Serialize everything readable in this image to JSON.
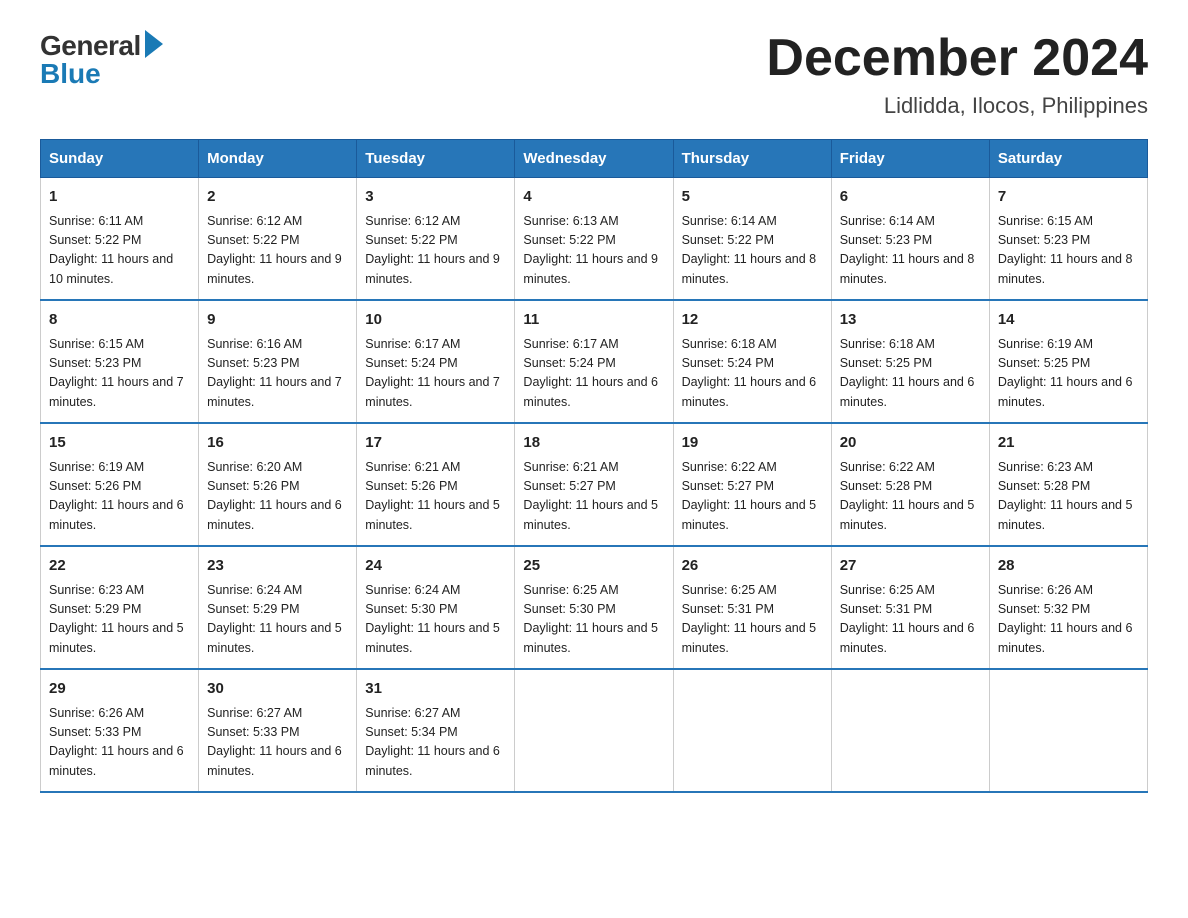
{
  "logo": {
    "general": "General",
    "blue": "Blue"
  },
  "title": "December 2024",
  "subtitle": "Lidlidda, Ilocos, Philippines",
  "days_of_week": [
    "Sunday",
    "Monday",
    "Tuesday",
    "Wednesday",
    "Thursday",
    "Friday",
    "Saturday"
  ],
  "weeks": [
    [
      {
        "day": "1",
        "sunrise": "6:11 AM",
        "sunset": "5:22 PM",
        "daylight": "11 hours and 10 minutes."
      },
      {
        "day": "2",
        "sunrise": "6:12 AM",
        "sunset": "5:22 PM",
        "daylight": "11 hours and 9 minutes."
      },
      {
        "day": "3",
        "sunrise": "6:12 AM",
        "sunset": "5:22 PM",
        "daylight": "11 hours and 9 minutes."
      },
      {
        "day": "4",
        "sunrise": "6:13 AM",
        "sunset": "5:22 PM",
        "daylight": "11 hours and 9 minutes."
      },
      {
        "day": "5",
        "sunrise": "6:14 AM",
        "sunset": "5:22 PM",
        "daylight": "11 hours and 8 minutes."
      },
      {
        "day": "6",
        "sunrise": "6:14 AM",
        "sunset": "5:23 PM",
        "daylight": "11 hours and 8 minutes."
      },
      {
        "day": "7",
        "sunrise": "6:15 AM",
        "sunset": "5:23 PM",
        "daylight": "11 hours and 8 minutes."
      }
    ],
    [
      {
        "day": "8",
        "sunrise": "6:15 AM",
        "sunset": "5:23 PM",
        "daylight": "11 hours and 7 minutes."
      },
      {
        "day": "9",
        "sunrise": "6:16 AM",
        "sunset": "5:23 PM",
        "daylight": "11 hours and 7 minutes."
      },
      {
        "day": "10",
        "sunrise": "6:17 AM",
        "sunset": "5:24 PM",
        "daylight": "11 hours and 7 minutes."
      },
      {
        "day": "11",
        "sunrise": "6:17 AM",
        "sunset": "5:24 PM",
        "daylight": "11 hours and 6 minutes."
      },
      {
        "day": "12",
        "sunrise": "6:18 AM",
        "sunset": "5:24 PM",
        "daylight": "11 hours and 6 minutes."
      },
      {
        "day": "13",
        "sunrise": "6:18 AM",
        "sunset": "5:25 PM",
        "daylight": "11 hours and 6 minutes."
      },
      {
        "day": "14",
        "sunrise": "6:19 AM",
        "sunset": "5:25 PM",
        "daylight": "11 hours and 6 minutes."
      }
    ],
    [
      {
        "day": "15",
        "sunrise": "6:19 AM",
        "sunset": "5:26 PM",
        "daylight": "11 hours and 6 minutes."
      },
      {
        "day": "16",
        "sunrise": "6:20 AM",
        "sunset": "5:26 PM",
        "daylight": "11 hours and 6 minutes."
      },
      {
        "day": "17",
        "sunrise": "6:21 AM",
        "sunset": "5:26 PM",
        "daylight": "11 hours and 5 minutes."
      },
      {
        "day": "18",
        "sunrise": "6:21 AM",
        "sunset": "5:27 PM",
        "daylight": "11 hours and 5 minutes."
      },
      {
        "day": "19",
        "sunrise": "6:22 AM",
        "sunset": "5:27 PM",
        "daylight": "11 hours and 5 minutes."
      },
      {
        "day": "20",
        "sunrise": "6:22 AM",
        "sunset": "5:28 PM",
        "daylight": "11 hours and 5 minutes."
      },
      {
        "day": "21",
        "sunrise": "6:23 AM",
        "sunset": "5:28 PM",
        "daylight": "11 hours and 5 minutes."
      }
    ],
    [
      {
        "day": "22",
        "sunrise": "6:23 AM",
        "sunset": "5:29 PM",
        "daylight": "11 hours and 5 minutes."
      },
      {
        "day": "23",
        "sunrise": "6:24 AM",
        "sunset": "5:29 PM",
        "daylight": "11 hours and 5 minutes."
      },
      {
        "day": "24",
        "sunrise": "6:24 AM",
        "sunset": "5:30 PM",
        "daylight": "11 hours and 5 minutes."
      },
      {
        "day": "25",
        "sunrise": "6:25 AM",
        "sunset": "5:30 PM",
        "daylight": "11 hours and 5 minutes."
      },
      {
        "day": "26",
        "sunrise": "6:25 AM",
        "sunset": "5:31 PM",
        "daylight": "11 hours and 5 minutes."
      },
      {
        "day": "27",
        "sunrise": "6:25 AM",
        "sunset": "5:31 PM",
        "daylight": "11 hours and 6 minutes."
      },
      {
        "day": "28",
        "sunrise": "6:26 AM",
        "sunset": "5:32 PM",
        "daylight": "11 hours and 6 minutes."
      }
    ],
    [
      {
        "day": "29",
        "sunrise": "6:26 AM",
        "sunset": "5:33 PM",
        "daylight": "11 hours and 6 minutes."
      },
      {
        "day": "30",
        "sunrise": "6:27 AM",
        "sunset": "5:33 PM",
        "daylight": "11 hours and 6 minutes."
      },
      {
        "day": "31",
        "sunrise": "6:27 AM",
        "sunset": "5:34 PM",
        "daylight": "11 hours and 6 minutes."
      },
      null,
      null,
      null,
      null
    ]
  ]
}
